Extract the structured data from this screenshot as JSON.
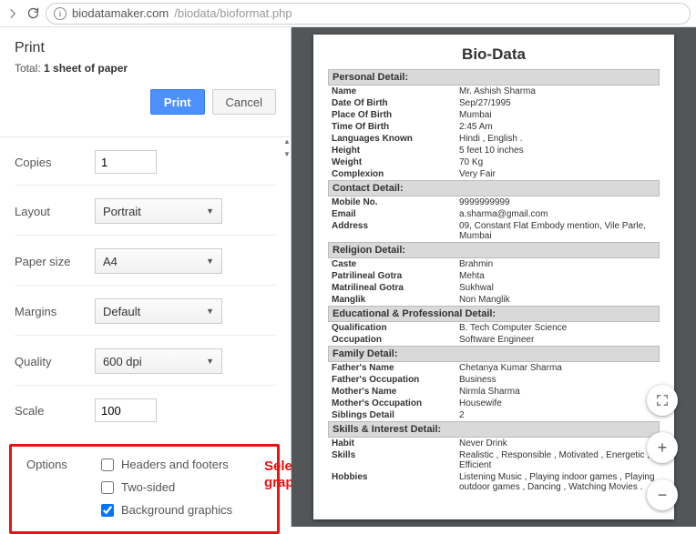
{
  "browser": {
    "url_host": "biodatamaker.com",
    "url_path": "/biodata/bioformat.php"
  },
  "print": {
    "title": "Print",
    "total_prefix": "Total: ",
    "total_value": "1 sheet of paper",
    "print_btn": "Print",
    "cancel_btn": "Cancel",
    "rows": {
      "copies_label": "Copies",
      "copies_value": "1",
      "layout_label": "Layout",
      "layout_value": "Portrait",
      "paper_label": "Paper size",
      "paper_value": "A4",
      "margins_label": "Margins",
      "margins_value": "Default",
      "quality_label": "Quality",
      "quality_value": "600 dpi",
      "scale_label": "Scale",
      "scale_value": "100",
      "options_label": "Options",
      "opt_headers": "Headers and footers",
      "opt_twosided": "Two-sided",
      "opt_bg": "Background graphics"
    }
  },
  "annotation": {
    "line1": "Select Background",
    "line2": "graphics checkbox"
  },
  "doc": {
    "title": "Bio-Data",
    "sections": {
      "personal": {
        "header": "Personal Detail:",
        "rows": [
          {
            "k": "Name",
            "v": "Mr. Ashish Sharma"
          },
          {
            "k": "Date Of Birth",
            "v": "Sep/27/1995"
          },
          {
            "k": "Place Of Birth",
            "v": "Mumbai"
          },
          {
            "k": "Time Of Birth",
            "v": "2:45 Am"
          },
          {
            "k": "Languages Known",
            "v": "Hindi , English ."
          },
          {
            "k": "Height",
            "v": "5 feet 10 inches"
          },
          {
            "k": "Weight",
            "v": "70 Kg"
          },
          {
            "k": "Complexion",
            "v": "Very Fair"
          }
        ]
      },
      "contact": {
        "header": "Contact Detail:",
        "rows": [
          {
            "k": "Mobile No.",
            "v": "9999999999"
          },
          {
            "k": "Email",
            "v": "a.sharma@gmail.com"
          },
          {
            "k": "Address",
            "v": "09, Constant Flat Embody mention, Vile Parle, Mumbai"
          }
        ]
      },
      "religion": {
        "header": "Religion Detail:",
        "rows": [
          {
            "k": "Caste",
            "v": "Brahmin"
          },
          {
            "k": "Patrilineal Gotra",
            "v": "Mehta"
          },
          {
            "k": "Matrilineal Gotra",
            "v": "Sukhwal"
          },
          {
            "k": "Manglik",
            "v": "Non Manglik"
          }
        ]
      },
      "edu": {
        "header": "Educational & Professional Detail:",
        "rows": [
          {
            "k": "Qualification",
            "v": "B. Tech Computer Science"
          },
          {
            "k": "Occupation",
            "v": "Software Engineer"
          }
        ]
      },
      "family": {
        "header": "Family Detail:",
        "rows": [
          {
            "k": "Father's Name",
            "v": "Chetanya Kumar Sharma"
          },
          {
            "k": "Father's Occupation",
            "v": "Business"
          },
          {
            "k": "Mother's Name",
            "v": "Nirmla Sharma"
          },
          {
            "k": "Mother's Occupation",
            "v": "Housewife"
          },
          {
            "k": "Siblings Detail",
            "v": "2"
          }
        ]
      },
      "skills": {
        "header": "Skills & Interest Detail:",
        "rows": [
          {
            "k": "Habit",
            "v": "Never Drink"
          },
          {
            "k": "Skills",
            "v": "Realistic , Responsible , Motivated , Energetic , Efficient"
          },
          {
            "k": "Hobbies",
            "v": "Listening Music , Playing indoor games , Playing outdoor games , Dancing , Watching Movies ."
          }
        ]
      }
    }
  }
}
